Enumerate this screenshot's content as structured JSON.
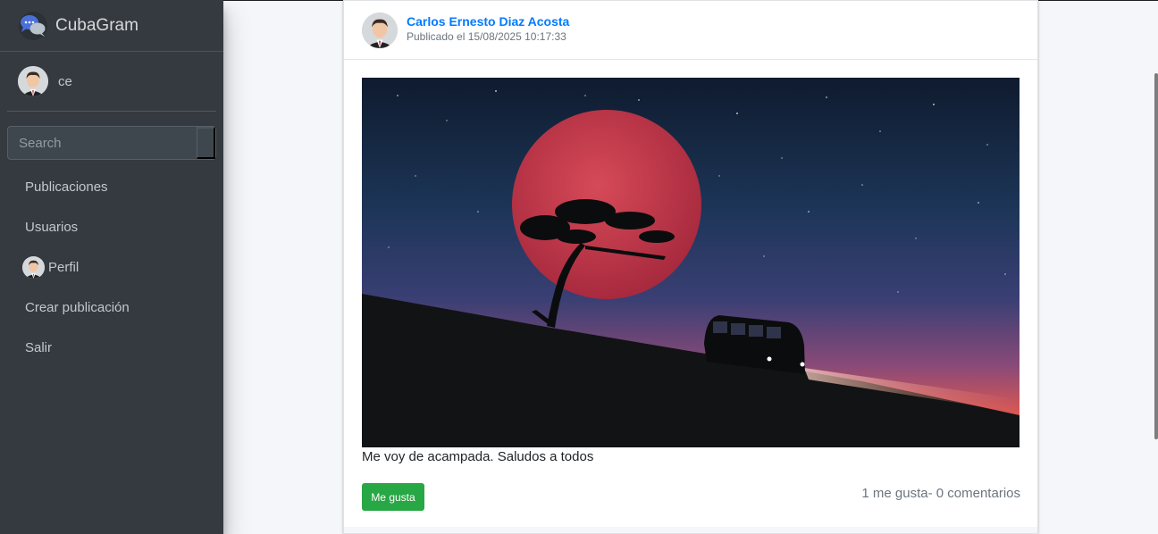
{
  "app": {
    "brand": "CubaGram"
  },
  "user": {
    "name": "ce"
  },
  "search": {
    "placeholder": "Search"
  },
  "nav": {
    "items": [
      {
        "label": "Publicaciones",
        "icon": ""
      },
      {
        "label": "Usuarios",
        "icon": ""
      },
      {
        "label": "Perfil",
        "icon": "avatar-icon"
      },
      {
        "label": "Crear publicación",
        "icon": ""
      },
      {
        "label": "Salir",
        "icon": ""
      }
    ]
  },
  "post": {
    "author": "Carlos Ernesto Diaz Acosta",
    "date": "Publicado el 15/08/2025 10:17:33",
    "caption": "Me voy de acampada. Saludos a todos",
    "like_label": "Me gusta",
    "stats": "1 me gusta- 0 comentarios"
  },
  "colors": {
    "sidebar_bg": "#343a40",
    "link": "#007bff",
    "like_button": "#28a745",
    "page_bg": "#f4f6f9"
  }
}
